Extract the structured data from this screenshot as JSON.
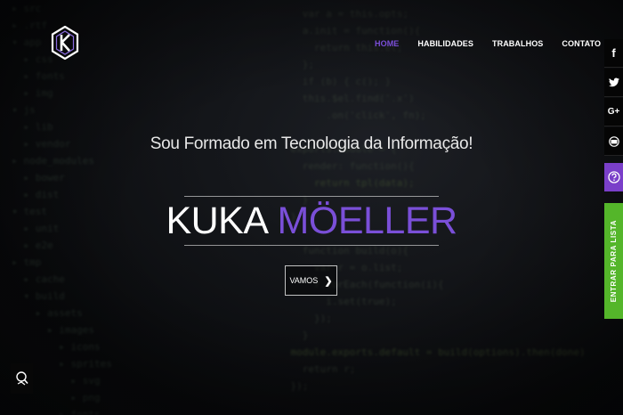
{
  "nav": {
    "items": [
      {
        "label": "HOME",
        "active": true
      },
      {
        "label": "HABILIDADES",
        "active": false
      },
      {
        "label": "TRABALHOS",
        "active": false
      },
      {
        "label": "CONTATO",
        "active": false
      }
    ]
  },
  "social": {
    "facebook": "f",
    "googleplus": "G+"
  },
  "sidebar": {
    "list_label": "ENTRAR PARA LISTA"
  },
  "hero": {
    "subtitle": "Sou Formado em Tecnologia da Informação!",
    "name_first": "KUKA",
    "name_last": "MÖELLER",
    "cta_label": "VAMOS"
  },
  "colors": {
    "accent": "#7a4fd8",
    "list_tab": "#54b62a",
    "help": "#7a3fc9"
  }
}
